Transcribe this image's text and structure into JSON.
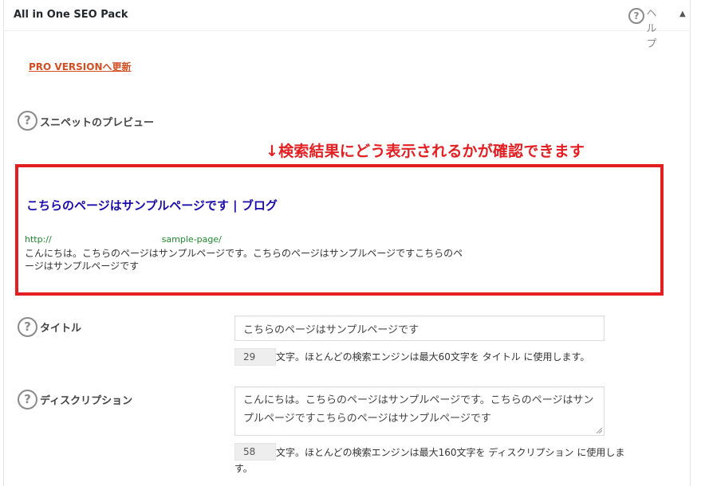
{
  "header": {
    "title": "All in One SEO Pack",
    "help_label": "ヘルプ",
    "toggle_glyph": "▲"
  },
  "pro_link": "PRO VERSIONへ更新",
  "snippet": {
    "label": "スニペットのプレビュー",
    "annotation": "↓検索結果にどう表示されるかが確認できます",
    "title": "こちらのページはサンプルページです | ブログ",
    "url_prefix": "http://",
    "url_suffix": "sample-page/",
    "description": "こんにちは。こちらのページはサンプルページです。こちらのページはサンプルページですこちらのページはサンプルページです"
  },
  "title_field": {
    "label": "タイトル",
    "value": "こちらのページはサンプルページです",
    "count": "29",
    "hint": "文字。ほとんどの検索エンジンは最大60文字を タイトル に使用します。"
  },
  "description_field": {
    "label": "ディスクリプション",
    "value": "こんにちは。こちらのページはサンプルページです。こちらのページはサンプルページですこちらのページはサンプルページです",
    "count": "58",
    "hint": "文字。ほとんどの検索エンジンは最大160文字を ディスクリプション に使用します。"
  },
  "icons": {
    "help": "question-circle-icon",
    "toggle": "triangle-up-icon"
  },
  "colors": {
    "annotation_red": "#e41f22",
    "link_orange": "#d54e21",
    "snippet_title_blue": "#1a0dab",
    "snippet_url_green": "#1e8a2d"
  }
}
